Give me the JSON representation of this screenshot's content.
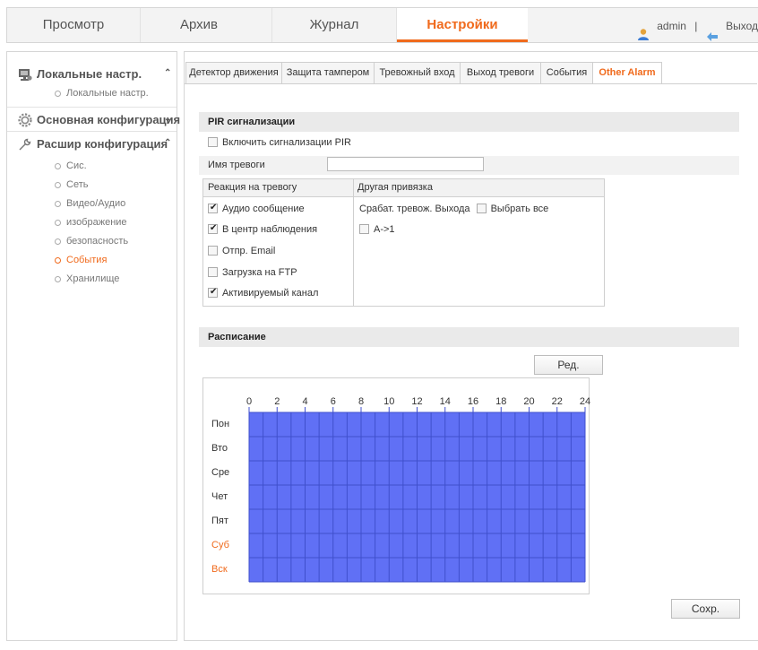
{
  "nav": {
    "tabs": [
      "Просмотр",
      "Архив",
      "Журнал",
      "Настройки"
    ],
    "active_tab": "Настройки",
    "user": "admin",
    "separator": "|",
    "logout": "Выход"
  },
  "sidebar": {
    "local": {
      "label": "Локальные настр.",
      "items": [
        "Локальные настр."
      ]
    },
    "basic": {
      "label": "Основная конфигурация"
    },
    "advanced": {
      "label": "Расшир конфигурация",
      "items": [
        "Сис.",
        "Сеть",
        "Видео/Аудио",
        "изображение",
        "безопасность",
        "События",
        "Хранилище"
      ],
      "active_item": "События"
    }
  },
  "tabs": [
    "Детектор движения",
    "Защита тампером",
    "Тревожный вход",
    "Выход тревоги",
    "События",
    "Other Alarm"
  ],
  "active_tab": "Other Alarm",
  "pir": {
    "section_title": "PIR сигнализации",
    "enable_label": "Включить сигнализации PIR",
    "enable_checked": false,
    "name_label": "Имя тревоги",
    "name_value": "",
    "reaction_header": "Реакция на тревогу",
    "other_header": "Другая привязка",
    "reactions": [
      {
        "label": "Аудио сообщение",
        "checked": true
      },
      {
        "label": "В центр наблюдения",
        "checked": true
      },
      {
        "label": "Отпр. Email",
        "checked": false
      },
      {
        "label": "Загрузка на FTP",
        "checked": false
      },
      {
        "label": "Активируемый канал",
        "checked": true
      }
    ],
    "trigger_output_label": "Срабат. тревож. Выхода",
    "select_all_label": "Выбрать все",
    "select_all_checked": false,
    "outputs": [
      {
        "label": "A->1",
        "checked": false
      }
    ]
  },
  "schedule": {
    "section_title": "Расписание",
    "edit_button": "Ред.",
    "hours": [
      "0",
      "2",
      "4",
      "6",
      "8",
      "10",
      "12",
      "14",
      "16",
      "18",
      "20",
      "22",
      "24"
    ],
    "days": [
      "Пон",
      "Вто",
      "Сре",
      "Чет",
      "Пят",
      "Суб",
      "Вск"
    ],
    "weekend_days": [
      "Суб",
      "Вск"
    ],
    "fill_color": "#6070f5",
    "grid_line_color": "#3f4fcc",
    "coverage": "all days 0-24"
  },
  "save_button": "Сохр.",
  "colors": {
    "accent": "#f06a1c",
    "header_bg": "#f3f3f3",
    "section_bg": "#eaeaea"
  }
}
